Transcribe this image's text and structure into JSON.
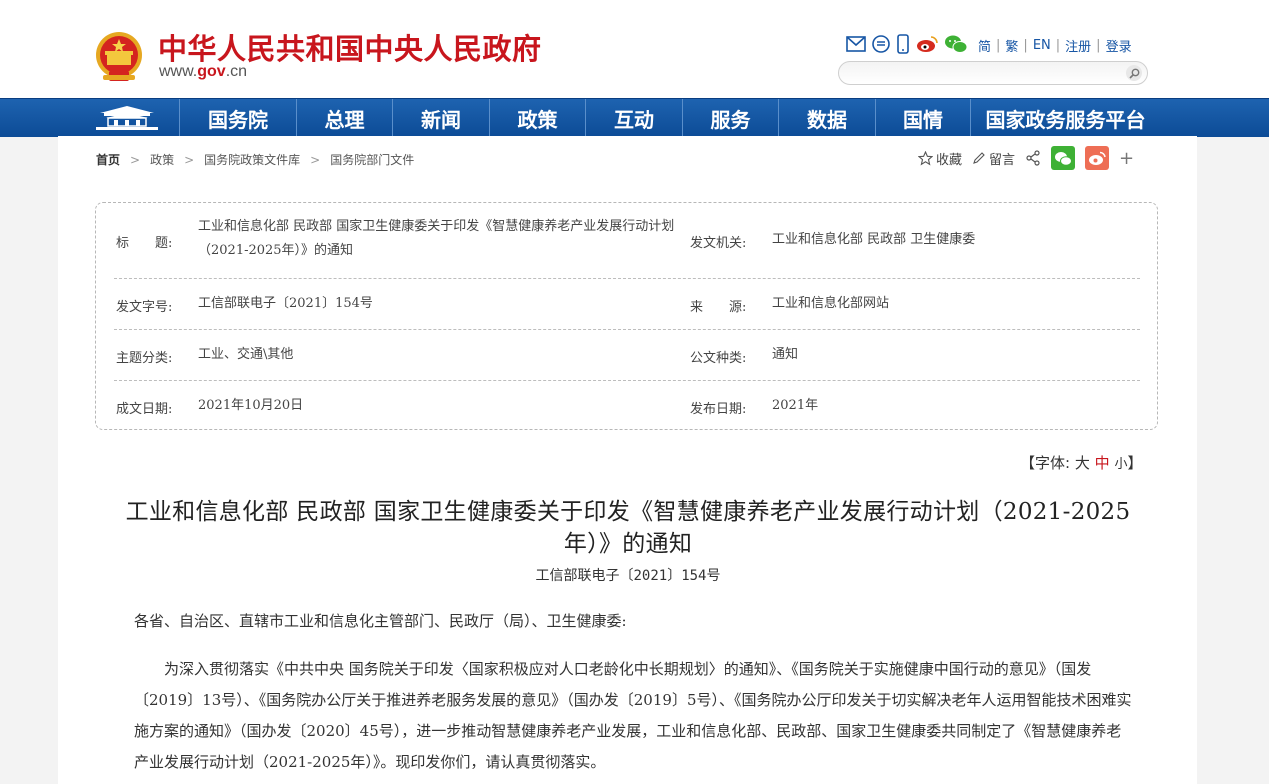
{
  "header": {
    "site_title": "中华人民共和国中央人民政府",
    "site_url_pre": "www.",
    "site_url_gov": "gov",
    "site_url_post": ".cn",
    "top_icons": [
      "mail-icon",
      "rss-icon",
      "mobile-icon",
      "weibo-icon",
      "wechat-icon"
    ],
    "top_links": [
      "简",
      "繁",
      "EN",
      "注册",
      "登录"
    ],
    "search_placeholder": ""
  },
  "nav": {
    "items": [
      "国务院",
      "总理",
      "新闻",
      "政策",
      "互动",
      "服务",
      "数据",
      "国情",
      "国家政务服务平台"
    ]
  },
  "breadcrumb": [
    "首页",
    "政策",
    "国务院政策文件库",
    "国务院部门文件"
  ],
  "tools": {
    "favorite": "收藏",
    "comment": "留言",
    "plus": "+"
  },
  "info": {
    "title_label": "标　　题:",
    "title_value": "工业和信息化部 民政部 国家卫生健康委关于印发《智慧健康养老产业发展行动计划（2021-2025年）》的通知",
    "issuer_label": "发文机关:",
    "issuer_value": "工业和信息化部 民政部 卫生健康委",
    "docno_label": "发文字号:",
    "docno_value": "工信部联电子〔2021〕154号",
    "source_label": "来　　源:",
    "source_value": "工业和信息化部网站",
    "topic_label": "主题分类:",
    "topic_value": "工业、交通\\其他",
    "type_label": "公文种类:",
    "type_value": "通知",
    "date_label": "成文日期:",
    "date_value": "2021年10月20日",
    "pub_label": "发布日期:",
    "pub_value": "2021年"
  },
  "font_switch": {
    "open": "【字体:",
    "large": "大",
    "medium": "中",
    "small": "小",
    "close": "】"
  },
  "article": {
    "title": "工业和信息化部 民政部 国家卫生健康委关于印发《智慧健康养老产业发展行动计划（2021-2025年）》的通知",
    "doc_number": "工信部联电子〔2021〕154号",
    "salutation": "各省、自治区、直辖市工业和信息化主管部门、民政厅（局）、卫生健康委:",
    "paragraph": "为深入贯彻落实《中共中央 国务院关于印发〈国家积极应对人口老龄化中长期规划〉的通知》、《国务院关于实施健康中国行动的意见》（国发〔2019〕13号）、《国务院办公厅关于推进养老服务发展的意见》（国办发〔2019〕5号）、《国务院办公厅印发关于切实解决老年人运用智能技术困难实施方案的通知》（国办发〔2020〕45号），进一步推动智慧健康养老产业发展，工业和信息化部、民政部、国家卫生健康委共同制定了《智慧健康养老产业发展行动计划（2021-2025年）》。现印发你们，请认真贯彻落实。"
  },
  "colors": {
    "brand_red": "#c8161d",
    "nav_blue": "#15589f",
    "link_blue": "#1756a5",
    "wechat_green": "#3eb135",
    "weibo_orange": "#ee6e55"
  }
}
